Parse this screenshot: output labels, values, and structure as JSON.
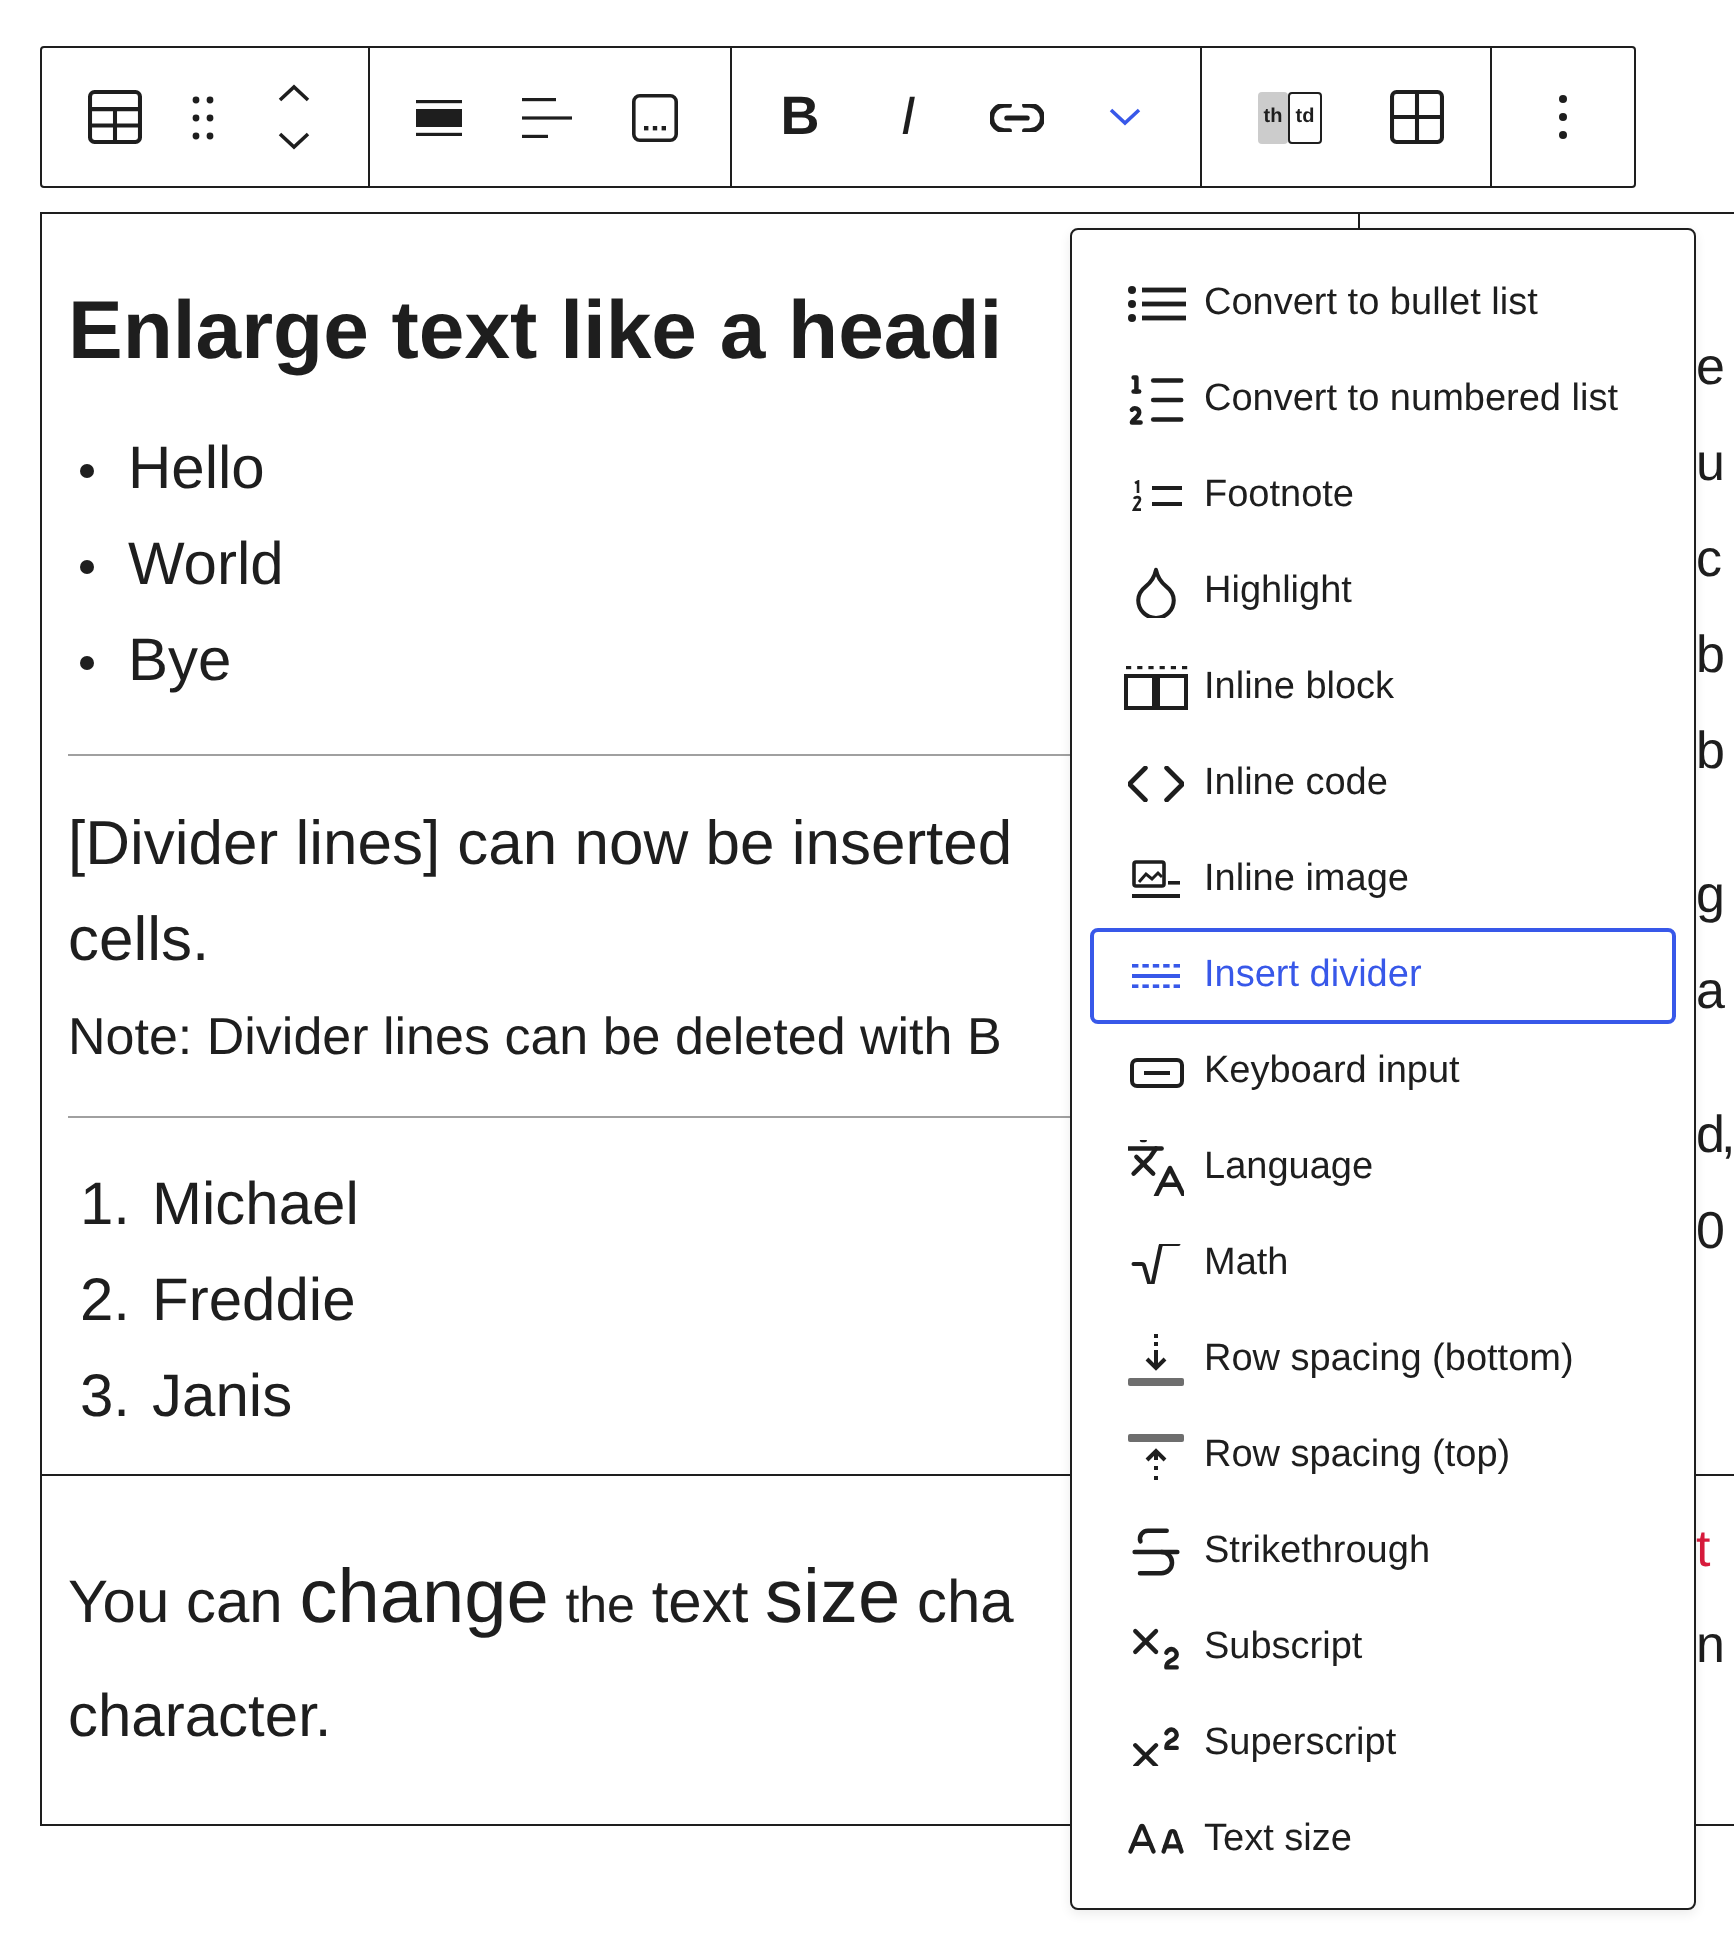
{
  "toolbar": {
    "bold": {
      "label": "B"
    },
    "italic": {
      "label": "I"
    },
    "more_formats": {
      "expanded": true
    },
    "cell_type": [
      {
        "label": "th",
        "selected": true
      },
      {
        "label": "td",
        "selected": false
      }
    ]
  },
  "table": {
    "rows": [
      {
        "cells": [
          {
            "blocks": [
              {
                "kind": "heading",
                "text": "Enlarge text like a headi"
              },
              {
                "kind": "bullet_list",
                "items": [
                  "Hello",
                  "World",
                  "Bye"
                ]
              },
              {
                "kind": "divider"
              },
              {
                "kind": "paragraph",
                "lines": [
                  "[Divider lines] can now be inserted",
                  "cells."
                ]
              },
              {
                "kind": "note",
                "text": "Note: Divider lines can be deleted with B"
              },
              {
                "kind": "divider"
              },
              {
                "kind": "numbered_list",
                "items": [
                  {
                    "number": "1.",
                    "text": "Michael"
                  },
                  {
                    "number": "2.",
                    "text": "Freddie"
                  },
                  {
                    "number": "3.",
                    "text": "Janis"
                  }
                ]
              }
            ]
          },
          {
            "blocks": [
              {
                "kind": "fragments",
                "lines": [
                  {
                    "text": "e"
                  },
                  {
                    "text": "u"
                  },
                  {
                    "text": "c"
                  },
                  {
                    "text": "b"
                  },
                  {
                    "text": "b"
                  }
                ]
              },
              {
                "kind": "fragments",
                "lines": [
                  {
                    "text": "g"
                  },
                  {
                    "text": "a"
                  }
                ]
              },
              {
                "kind": "fragments",
                "lines": [
                  {
                    "text": "d,"
                  },
                  {
                    "text": "0"
                  }
                ]
              }
            ]
          }
        ]
      },
      {
        "cells": [
          {
            "blocks": [
              {
                "kind": "sized_paragraph",
                "lines": [
                  [
                    {
                      "text": "You can",
                      "kind": "normal"
                    },
                    {
                      "text": "change",
                      "kind": "large"
                    },
                    {
                      "text": "the",
                      "kind": "small"
                    },
                    {
                      "text": "text",
                      "kind": "normal"
                    },
                    {
                      "text": "size",
                      "kind": "large"
                    },
                    {
                      "text": "cha",
                      "kind": "normal"
                    }
                  ],
                  [
                    {
                      "text": "character.",
                      "kind": "normal"
                    }
                  ]
                ]
              }
            ]
          },
          {
            "blocks": [
              {
                "kind": "fragments",
                "lines": [
                  {
                    "text": "t",
                    "color": "#d81b3c"
                  },
                  {
                    "text": "n"
                  }
                ]
              }
            ]
          }
        ]
      }
    ]
  },
  "format_menu": {
    "items": [
      {
        "label": "Convert to bullet list",
        "selected": false
      },
      {
        "label": "Convert to numbered list",
        "selected": false
      },
      {
        "label": "Footnote",
        "selected": false
      },
      {
        "label": "Highlight",
        "selected": false
      },
      {
        "label": "Inline block",
        "selected": false
      },
      {
        "label": "Inline code",
        "selected": false
      },
      {
        "label": "Inline image",
        "selected": false
      },
      {
        "label": "Insert divider",
        "selected": true
      },
      {
        "label": "Keyboard input",
        "selected": false
      },
      {
        "label": "Language",
        "selected": false
      },
      {
        "label": "Math",
        "selected": false
      },
      {
        "label": "Row spacing (bottom)",
        "selected": false
      },
      {
        "label": "Row spacing (top)",
        "selected": false
      },
      {
        "label": "Strikethrough",
        "selected": false
      },
      {
        "label": "Subscript",
        "selected": false
      },
      {
        "label": "Superscript",
        "selected": false
      },
      {
        "label": "Text size",
        "selected": false
      }
    ]
  }
}
